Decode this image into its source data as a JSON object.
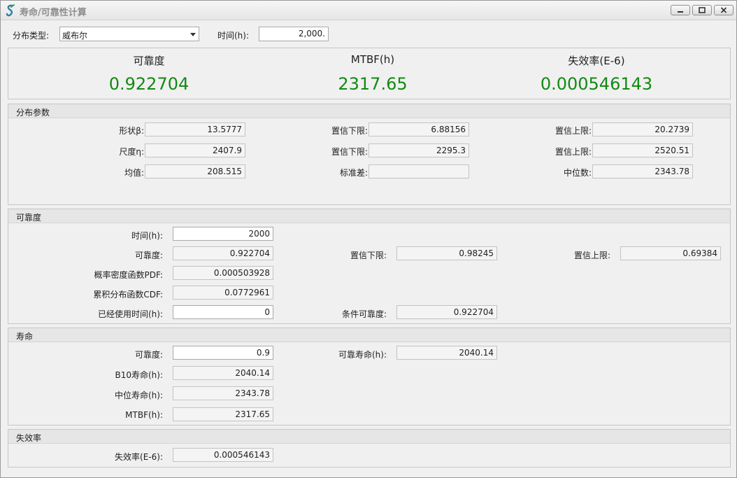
{
  "window": {
    "title": "寿命/可靠性计算",
    "minimize_glyph": "—",
    "maximize_glyph": "□",
    "close_glyph": "✕"
  },
  "top": {
    "dist_type_label": "分布类型:",
    "dist_type_value": "威布尔",
    "time_label": "时间(h):",
    "time_value": "2,000."
  },
  "summary": {
    "reliability_label": "可靠度",
    "reliability_value": "0.922704",
    "mtbf_label": "MTBF(h)",
    "mtbf_value": "2317.65",
    "failure_rate_label": "失效率(E-6)",
    "failure_rate_value": "0.000546143",
    "value_color": "#128a12"
  },
  "dist_params": {
    "title": "分布参数",
    "shape_label": "形状β:",
    "shape_value": "13.5777",
    "shape_lower_label": "置信下限:",
    "shape_lower_value": "6.88156",
    "shape_upper_label": "置信上限:",
    "shape_upper_value": "20.2739",
    "scale_label": "尺度η:",
    "scale_value": "2407.9",
    "scale_lower_label": "置信下限:",
    "scale_lower_value": "2295.3",
    "scale_upper_label": "置信上限:",
    "scale_upper_value": "2520.51",
    "mean_label": "均值:",
    "mean_value": "208.515",
    "std_label": "标准差:",
    "std_value": "",
    "median_label": "中位数:",
    "median_value": "2343.78"
  },
  "reliability": {
    "title": "可靠度",
    "time_label": "时间(h):",
    "time_value": "2000",
    "rel_label": "可靠度:",
    "rel_value": "0.922704",
    "rel_lower_label": "置信下限:",
    "rel_lower_value": "0.98245",
    "rel_upper_label": "置信上限:",
    "rel_upper_value": "0.69384",
    "pdf_label": "概率密度函数PDF:",
    "pdf_value": "0.000503928",
    "cdf_label": "累积分布函数CDF:",
    "cdf_value": "0.0772961",
    "used_time_label": "已经使用时间(h):",
    "used_time_value": "0",
    "cond_rel_label": "条件可靠度:",
    "cond_rel_value": "0.922704"
  },
  "life": {
    "title": "寿命",
    "rel_label": "可靠度:",
    "rel_value": "0.9",
    "rel_life_label": "可靠寿命(h):",
    "rel_life_value": "2040.14",
    "b10_label": "B10寿命(h):",
    "b10_value": "2040.14",
    "median_label": "中位寿命(h):",
    "median_value": "2343.78",
    "mtbf_label": "MTBF(h):",
    "mtbf_value": "2317.65"
  },
  "failure": {
    "title": "失效率",
    "rate_label": "失效率(E-6):",
    "rate_value": "0.000546143"
  }
}
